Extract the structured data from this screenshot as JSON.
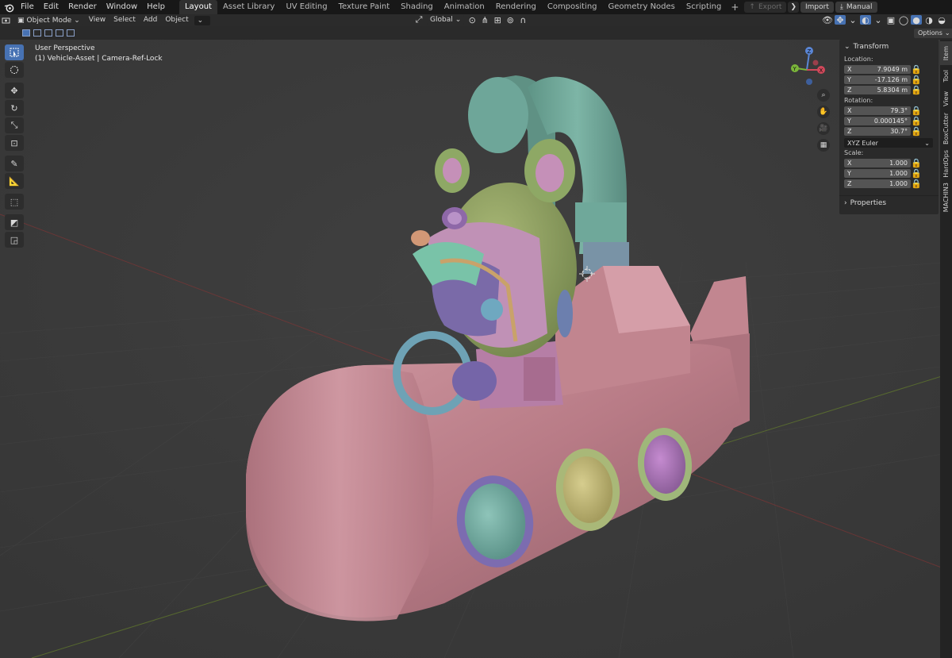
{
  "menu": [
    "File",
    "Edit",
    "Render",
    "Window",
    "Help"
  ],
  "workspaces": [
    "Layout",
    "Asset Library",
    "UV Editing",
    "Texture Paint",
    "Shading",
    "Animation",
    "Rendering",
    "Compositing",
    "Geometry Nodes",
    "Scripting"
  ],
  "active_workspace": "Layout",
  "top_buttons": {
    "export": "Export",
    "import": "Import",
    "manual": "Manual"
  },
  "viewport_header": {
    "mode": "Object Mode",
    "menus": [
      "View",
      "Select",
      "Add",
      "Object"
    ],
    "orientation": "Global"
  },
  "options_label": "Options",
  "overlay": {
    "perspective": "User Perspective",
    "object_info": "(1) Vehicle-Asset | Camera-Ref-Lock"
  },
  "gizmo": {
    "x": "X",
    "y": "Y",
    "z": "Z"
  },
  "npanel": {
    "transform_label": "Transform",
    "location_label": "Location:",
    "location": [
      {
        "axis": "X",
        "value": "7.9049 m"
      },
      {
        "axis": "Y",
        "value": "-17.126 m"
      },
      {
        "axis": "Z",
        "value": "5.8304 m"
      }
    ],
    "rotation_label": "Rotation:",
    "rotation": [
      {
        "axis": "X",
        "value": "79.3°"
      },
      {
        "axis": "Y",
        "value": "0.000145°"
      },
      {
        "axis": "Z",
        "value": "30.7°"
      }
    ],
    "rotation_mode": "XYZ Euler",
    "scale_label": "Scale:",
    "scale": [
      {
        "axis": "X",
        "value": "1.000"
      },
      {
        "axis": "Y",
        "value": "1.000"
      },
      {
        "axis": "Z",
        "value": "1.000"
      }
    ],
    "properties_label": "Properties"
  },
  "sidebar_tabs": [
    "Item",
    "Tool",
    "View",
    "BoxCutter",
    "HardOps",
    "MACHIN3"
  ],
  "colors": {
    "accent": "#4772b3",
    "sub_pink": "#c98593",
    "helmet_green": "#9aae6a",
    "pipe_teal": "#6fa89a",
    "face_purple": "#7a6aa8"
  }
}
